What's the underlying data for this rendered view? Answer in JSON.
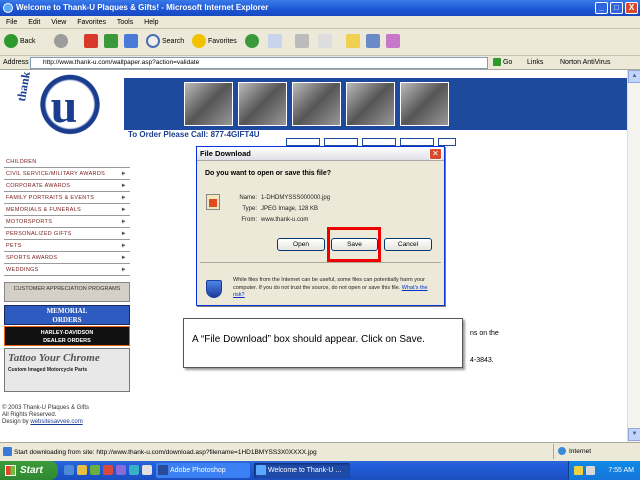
{
  "window": {
    "title": "Welcome to Thank-U Plaques & Gifts! - Microsoft Internet Explorer",
    "controls": [
      "_",
      "□",
      "X"
    ]
  },
  "menubar": [
    "File",
    "Edit",
    "View",
    "Favorites",
    "Tools",
    "Help"
  ],
  "toolbar": {
    "back": "Back",
    "search": "Search",
    "favorites": "Favorites"
  },
  "address": {
    "label": "Address",
    "url": "http://www.thank-u.com/wallpaper.asp?action=validate",
    "go": "Go",
    "links": "Links",
    "norton": "Norton AntiVirus"
  },
  "site": {
    "logo_letter": "u",
    "logo_word": "thank",
    "phone_label": "To Order Please Call:",
    "phone_number": "877-4GIFT4U",
    "sidebar": [
      "CHILDREN",
      "CIVIL SERVICE/MILITARY AWARDS",
      "CORPORATE AWARDS",
      "FAMILY PORTRAITS & EVENTS",
      "MEMORIALS & FUNERALS",
      "MOTORSPORTS",
      "PERSONALIZED GIFTS",
      "PETS",
      "SPORTS AWARDS",
      "WEDDINGS"
    ],
    "customer_appreciation": "CUSTOMER APPRECIATION PROGRAMS",
    "memorial_line1": "MEMORIAL",
    "memorial_line2": "ORDERS",
    "harley_line1": "HARLEY-DAVIDSON",
    "harley_line2": "DEALER ORDERS",
    "tattoo_title": "Tattoo Your Chrome",
    "tattoo_sub": "Custom Imaged Motorcycle Parts",
    "footer_line1": "© 2003 Thank-U Plaques & Gifts",
    "footer_line2": "All Rights Reserved.",
    "footer_line3": "Design by",
    "footer_link": "websitesavvee.com",
    "right_text1": "ns on the",
    "right_text2": "4-3843."
  },
  "dialog": {
    "title": "File Download",
    "question": "Do you want to open or save this file?",
    "name_label": "Name:",
    "name_value": "1-DHDMYSSS000000.jpg",
    "type_label": "Type:",
    "type_value": "JPEG Image, 128 KB",
    "from_label": "From:",
    "from_value": "www.thank-u.com",
    "open": "Open",
    "save": "Save",
    "cancel": "Cancel",
    "warning": "While files from the Internet can be useful, some files can potentially harm your computer. If you do not trust the source, do not open or save this file.",
    "risk_link": "What's the risk?"
  },
  "callout": {
    "text": "A “File Download” box should appear. Click on Save."
  },
  "statusbar": {
    "text": "Start downloading from site: http://www.thank-u.com/download.asp?filename=1HD1BMYSS3X0XXXX.jpg",
    "zone": "Internet"
  },
  "taskbar": {
    "start": "Start",
    "tasks": [
      "Adobe Photoshop",
      "Welcome to Thank-U ..."
    ],
    "clock": "7:55 AM"
  }
}
